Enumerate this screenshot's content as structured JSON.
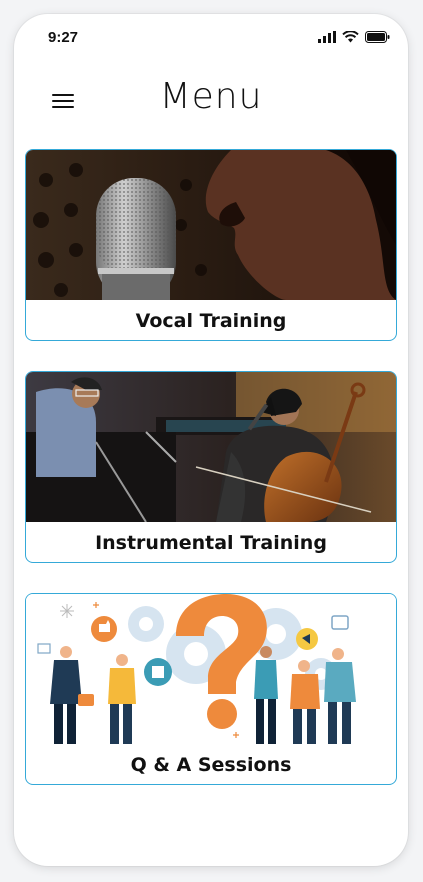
{
  "status_bar": {
    "time": "9:27"
  },
  "header": {
    "title": "Menu"
  },
  "menu_items": [
    {
      "label": "Vocal Training"
    },
    {
      "label": "Instrumental Training"
    },
    {
      "label": "Q & A Sessions"
    }
  ],
  "colors": {
    "card_border": "#35a9d8",
    "accent_orange": "#ee8a3c"
  }
}
